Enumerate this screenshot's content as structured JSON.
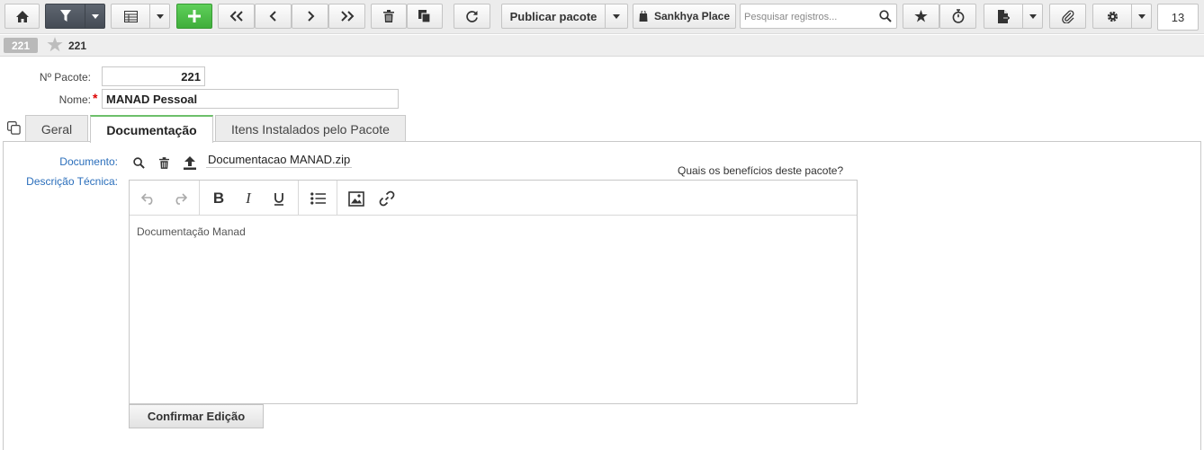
{
  "toolbar": {
    "publish_label": "Publicar pacote",
    "place_label": "Sankhya Place",
    "search_placeholder": "Pesquisar registros...",
    "record_count": "13",
    "colors": {
      "dark_button": "#4f565f",
      "green_button": "#46b342"
    }
  },
  "record_bar": {
    "badge": "221",
    "title": "221"
  },
  "form": {
    "pacote_label": "Nº Pacote:",
    "pacote_value": "221",
    "nome_label": "Nome:",
    "nome_value": "MANAD Pessoal"
  },
  "tabs": [
    {
      "label": "Geral"
    },
    {
      "label": "Documentação",
      "active": true
    },
    {
      "label": "Itens Instalados pelo Pacote"
    }
  ],
  "documentation": {
    "documento_label": "Documento:",
    "filename": "Documentacao MANAD.zip",
    "descricao_label": "Descrição Técnica:",
    "benefits_link": "Quais os benefícios deste pacote?",
    "editor_content": "Documentação Manad",
    "confirm_label": "Confirmar Edição"
  },
  "accent_color": "#6dbf6a",
  "label_blue": "#2a6ebb"
}
